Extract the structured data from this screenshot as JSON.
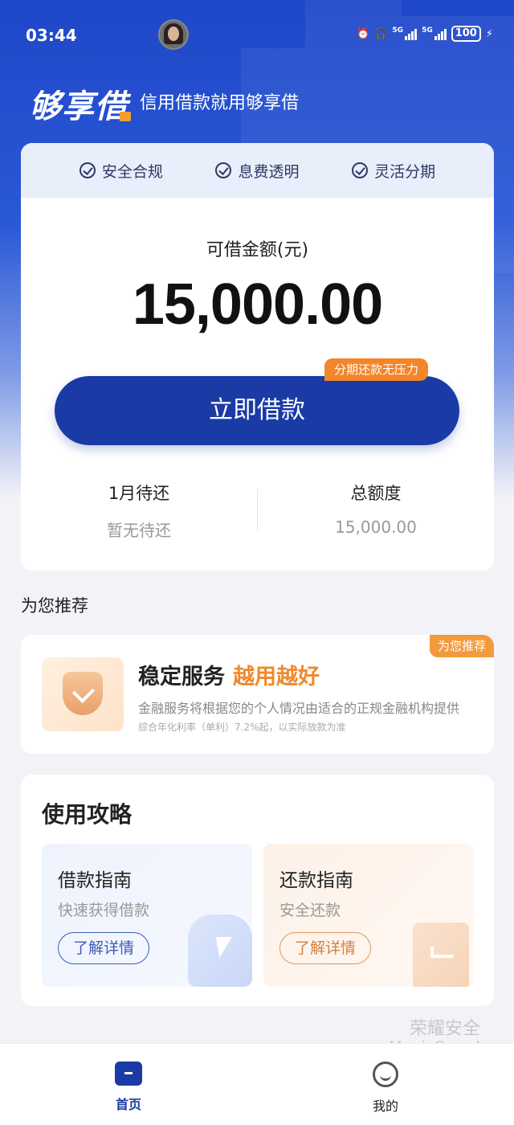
{
  "status_bar": {
    "time": "03:44",
    "signal1_label": "5G",
    "signal2_label": "5G",
    "battery": "100",
    "icons": [
      "alarm-icon",
      "headphones-icon",
      "vibrate-icon",
      "signal-icon",
      "signal-icon",
      "battery-icon",
      "charging-icon"
    ]
  },
  "header": {
    "logo": "够享借",
    "slogan": "信用借款就用够享借"
  },
  "features": [
    {
      "label": "安全合规",
      "icon": "check-circle-icon"
    },
    {
      "label": "息费透明",
      "icon": "check-circle-icon"
    },
    {
      "label": "灵活分期",
      "icon": "check-circle-icon"
    }
  ],
  "loan": {
    "amount_label": "可借金额(元)",
    "amount": "15,000.00",
    "borrow_button": "立即借款",
    "promo_tag": "分期还款无压力",
    "due_title": "1月待还",
    "due_value": "暂无待还",
    "total_title": "总额度",
    "total_value": "15,000.00"
  },
  "recommend": {
    "section_title": "为您推荐",
    "tag": "为您推荐",
    "title": "稳定服务",
    "title_highlight": "越用越好",
    "desc": "金融服务将根据您的个人情况由适合的正规金融机构提供",
    "note": "综合年化利率（单利）7.2%起，以实际放款为准"
  },
  "guide": {
    "title": "使用攻略",
    "tiles": [
      {
        "title": "借款指南",
        "subtitle": "快速获得借款",
        "button": "了解详情"
      },
      {
        "title": "还款指南",
        "subtitle": "安全还款",
        "button": "了解详情"
      }
    ]
  },
  "watermark": {
    "line1": "荣耀安全",
    "line2": "MagicGuard"
  },
  "nav": {
    "home": "首页",
    "mine": "我的"
  },
  "colors": {
    "brand_blue": "#1a3aa5",
    "accent_orange": "#f0892c"
  }
}
